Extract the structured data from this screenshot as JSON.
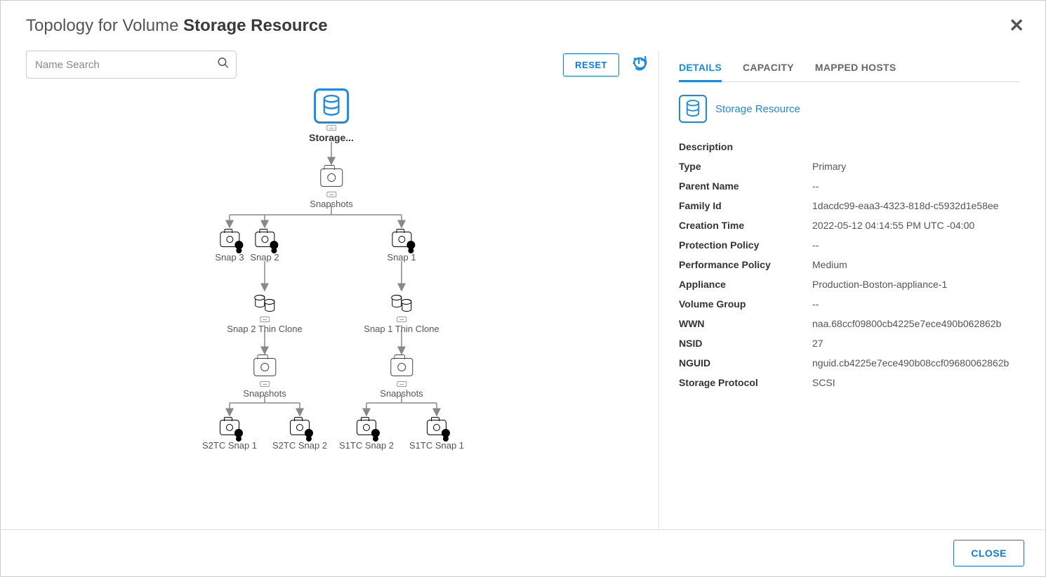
{
  "header": {
    "title_prefix": "Topology for Volume ",
    "title_bold": "Storage Resource"
  },
  "toolbar": {
    "search_placeholder": "Name Search",
    "reset_label": "RESET"
  },
  "topology": {
    "root": "Storage...",
    "snapshots_label": "Snapshots",
    "snap3": "Snap 3",
    "snap2": "Snap 2",
    "snap1": "Snap 1",
    "snap2_clone": "Snap 2 Thin Clone",
    "snap1_clone": "Snap 1 Thin Clone",
    "s2tc_snap1": "S2TC Snap 1",
    "s2tc_snap2": "S2TC Snap 2",
    "s1tc_snap2": "S1TC Snap 2",
    "s1tc_snap1": "S1TC Snap 1"
  },
  "tabs": {
    "details": "DETAILS",
    "capacity": "CAPACITY",
    "mapped_hosts": "MAPPED HOSTS"
  },
  "resource": {
    "name": "Storage Resource"
  },
  "details_labels": {
    "description": "Description",
    "type": "Type",
    "parent_name": "Parent Name",
    "family_id": "Family Id",
    "creation_time": "Creation Time",
    "protection_policy": "Protection Policy",
    "performance_policy": "Performance Policy",
    "appliance": "Appliance",
    "volume_group": "Volume Group",
    "wwn": "WWN",
    "nsid": "NSID",
    "nguid": "NGUID",
    "storage_protocol": "Storage Protocol"
  },
  "details_values": {
    "description": "",
    "type": "Primary",
    "parent_name": "--",
    "family_id": "1dacdc99-eaa3-4323-818d-c5932d1e58ee",
    "creation_time": "2022-05-12 04:14:55 PM UTC -04:00",
    "protection_policy": "--",
    "performance_policy": "Medium",
    "appliance": "Production-Boston-appliance-1",
    "volume_group": "--",
    "wwn": "naa.68ccf09800cb4225e7ece490b062862b",
    "nsid": "27",
    "nguid": "nguid.cb4225e7ece490b08ccf09680062862b",
    "storage_protocol": "SCSI"
  },
  "footer": {
    "close_label": "CLOSE"
  }
}
